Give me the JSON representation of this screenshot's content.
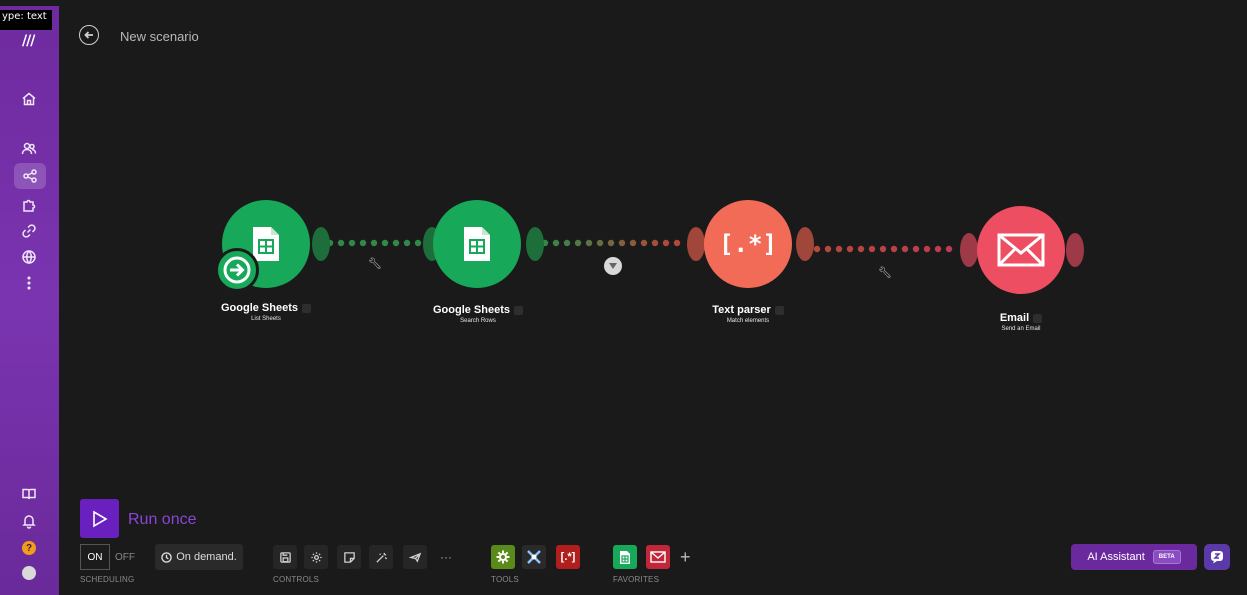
{
  "type_tag": "ype: text",
  "logo_text": "///",
  "scenario": {
    "title": "New scenario"
  },
  "nodes": [
    {
      "app": "Google Sheets",
      "action": "List Sheets",
      "color": "#17a85a"
    },
    {
      "app": "Google Sheets",
      "action": "Search Rows",
      "color": "#17a85a"
    },
    {
      "app": "Text parser",
      "action": "Match elements",
      "color": "#f26b57"
    },
    {
      "app": "Email",
      "action": "Send an Email",
      "color": "#ee4e62"
    }
  ],
  "parser_glyph": "[.*]",
  "run": {
    "label": "Run once"
  },
  "scheduling": {
    "on_label": "ON",
    "off_label": "OFF",
    "schedule_label": "On demand.",
    "section_label": "SCHEDULING"
  },
  "controls": {
    "section_label": "CONTROLS",
    "more_label": "···"
  },
  "tools": {
    "section_label": "TOOLS",
    "parser_label": "[.*]"
  },
  "favorites": {
    "section_label": "FAVORITES",
    "add_label": "+"
  },
  "ai_assistant": {
    "label": "AI Assistant",
    "badge": "BETA"
  },
  "help": {
    "label": "?"
  },
  "colors": {
    "sidebar": "#6e2a9e",
    "accent": "#6a1fbf",
    "sheets_green": "#17a85a",
    "parser_orange": "#f26b57",
    "email_red": "#ee4e62"
  }
}
